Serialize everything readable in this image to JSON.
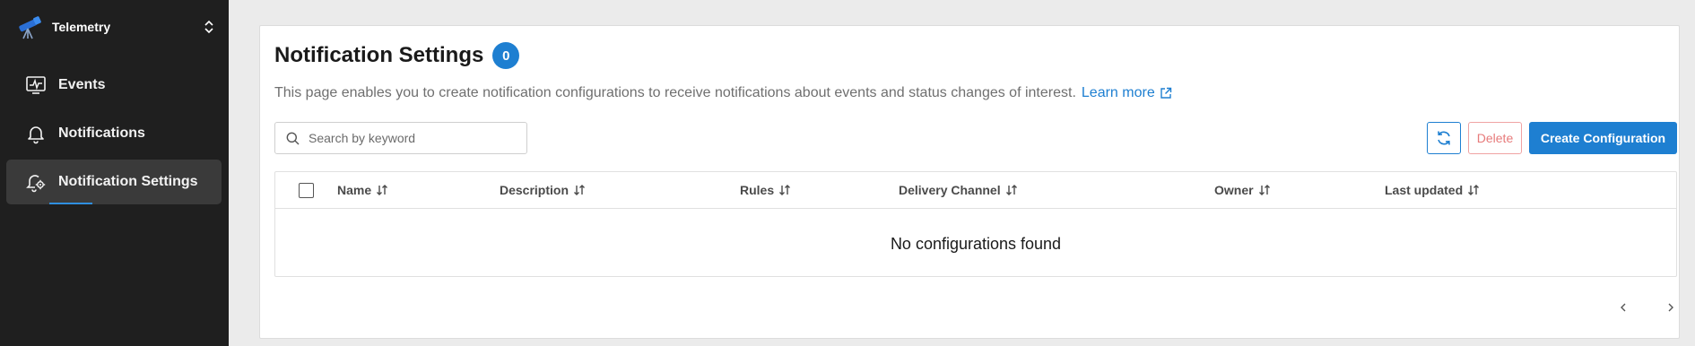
{
  "app": {
    "name": "Telemetry",
    "logo_icon": "telescope-icon",
    "switcher_icon": "chevron-up-down-icon"
  },
  "sidebar": {
    "items": [
      {
        "label": "Events",
        "icon": "monitor-activity-icon",
        "active": false
      },
      {
        "label": "Notifications",
        "icon": "bell-icon",
        "active": false
      },
      {
        "label": "Notification Settings",
        "icon": "bell-gear-icon",
        "active": true
      }
    ]
  },
  "page": {
    "title": "Notification Settings",
    "count": "0",
    "description": "This page enables you to create notification configurations to receive notifications about events and status changes of interest.",
    "learn_more": "Learn more"
  },
  "search": {
    "placeholder": "Search by keyword",
    "value": ""
  },
  "toolbar": {
    "delete_label": "Delete",
    "create_label": "Create Configuration"
  },
  "table": {
    "columns": [
      "Name",
      "Description",
      "Rules",
      "Delivery Channel",
      "Owner",
      "Last updated"
    ],
    "empty_message": "No configurations found"
  },
  "colors": {
    "accent": "#1e7fd1",
    "sidebar_bg": "#1f1f1f",
    "danger": "#e77b7b"
  }
}
